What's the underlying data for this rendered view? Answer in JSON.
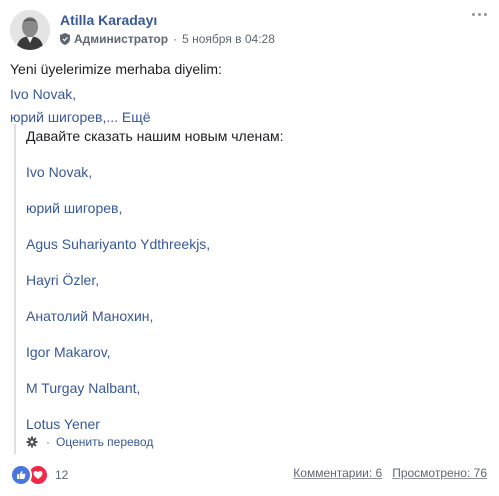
{
  "post": {
    "author": "Atilla Karadayı",
    "role": "Администратор",
    "separator": "·",
    "timestamp": "5 ноября в 04:28",
    "icons": {
      "role": "shield-icon",
      "more": "more-options-icon"
    },
    "body": {
      "line1": "Yeni üyelerimize merhaba diyelim:",
      "line2": "Ivo Novak,",
      "line3_prefix": "юрий шигорев,... ",
      "see_more": "Ещё"
    },
    "translation": {
      "intro": "Давайте сказать нашим новым членам:",
      "names": [
        "Ivo Novak,",
        "юрий шигорев,",
        "Agus Suhariyanto Ydthreekjs,",
        "Hayri Özler,",
        "Анатолий Манохин,",
        "Igor Makarov,",
        "M Turgay Nalbant,",
        "Lotus Yener"
      ],
      "separator": "·",
      "rate_label": "Оценить перевод"
    },
    "footer": {
      "reaction_count": "12",
      "reaction_icons": [
        "like-icon",
        "love-icon"
      ],
      "comments": "Комментарии: 6",
      "views": "Просмотрено: 76"
    }
  },
  "colors": {
    "link": "#385898",
    "text": "#1c1e21",
    "meta": "#606770",
    "like": "#4a76e0",
    "love": "#f0284a"
  }
}
